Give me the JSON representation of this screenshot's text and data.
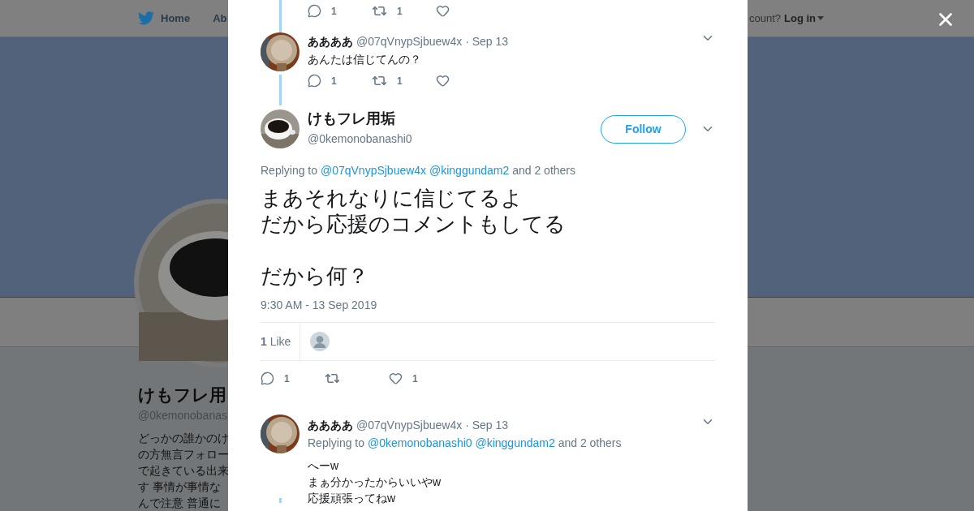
{
  "background": {
    "nav": {
      "home": "Home",
      "about": "Ab",
      "account_prompt": "count?",
      "login": "Log in"
    },
    "profile": {
      "name": "けもフレ用",
      "handle": "@0kemonobanas",
      "bio": [
        "どっかの誰かのけ",
        "の方無言フォロー",
        "で起きている出来",
        "す 事情が事情な",
        "んで注意 普通に"
      ]
    }
  },
  "modal": {
    "top_actions": {
      "replies": "1",
      "retweets": "1"
    },
    "parent_tweet": {
      "name": "ああああ",
      "handle": "@07qVnypSjbuew4x",
      "date": "· Sep 13",
      "text": "あんたは信じてんの？",
      "replies": "1",
      "retweets": "1"
    },
    "focused_tweet": {
      "name": "けもフレ用垢",
      "handle": "@0kemonobanashi0",
      "follow": "Follow",
      "replying_prefix": "Replying to",
      "replying_to": [
        "@07qVnypSjbuew4x",
        "@kinggundam2"
      ],
      "replying_suffix": "and 2 others",
      "paragraphs": [
        [
          "まあそれなりに信じてるよ",
          "だから応援のコメントもしてる"
        ],
        [
          "だから何？"
        ]
      ],
      "timestamp": "9:30 AM - 13 Sep 2019",
      "likes_summary": "**1** Like",
      "replies": "1",
      "likes": "1"
    },
    "reply_tweet": {
      "name": "ああああ",
      "handle": "@07qVnypSjbuew4x",
      "date": "· Sep 13",
      "replying_prefix": "Replying to",
      "replying_to": [
        "@0kemonobanashi0",
        "@kinggundam2"
      ],
      "replying_suffix": "and 2 others",
      "lines": [
        "へーw",
        "まぁ分かったからいいやw",
        "応援頑張ってねw"
      ]
    }
  }
}
